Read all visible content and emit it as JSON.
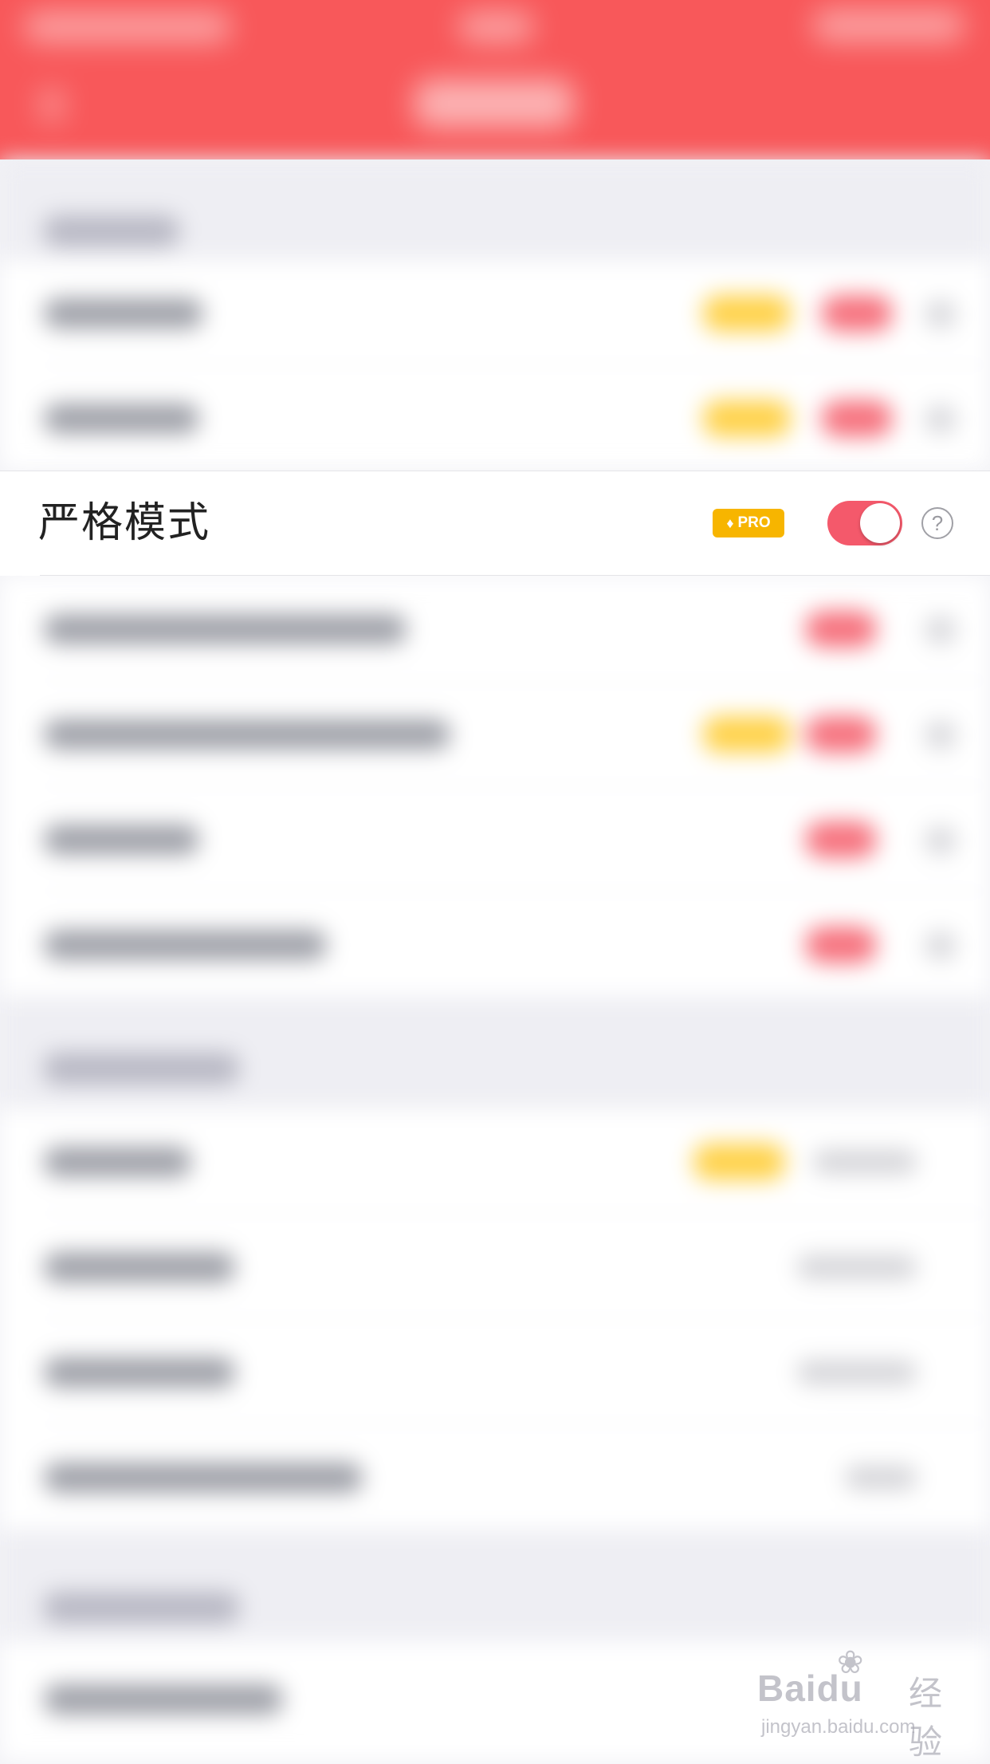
{
  "strict_mode": {
    "label": "严格模式",
    "pro_badge": "PRO",
    "diamond": "♦",
    "toggle_on": true,
    "help": "?"
  },
  "watermark": {
    "brand": "Baidu",
    "brand_cn": "经验",
    "url": "jingyan.baidu.com"
  },
  "colors": {
    "header": "#f8585a",
    "toggle_on": "#f4596b",
    "pro_badge": "#f7b500"
  }
}
